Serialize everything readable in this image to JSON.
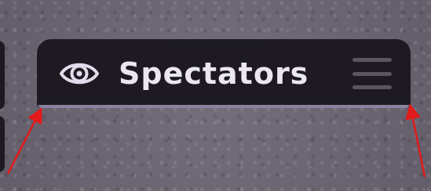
{
  "spectators_panel": {
    "title": "Spectators",
    "icons": {
      "eye": "eye-icon",
      "menu": "hamburger-menu-icon"
    },
    "colors": {
      "panel_background": "#1d1b21",
      "title_text": "#ebe7f0",
      "eye_icon": "#e3dced",
      "menu_icon": "#5a5660",
      "rim": "#8a83a0"
    }
  },
  "annotations": {
    "arrow_color": "#e11b1b"
  }
}
